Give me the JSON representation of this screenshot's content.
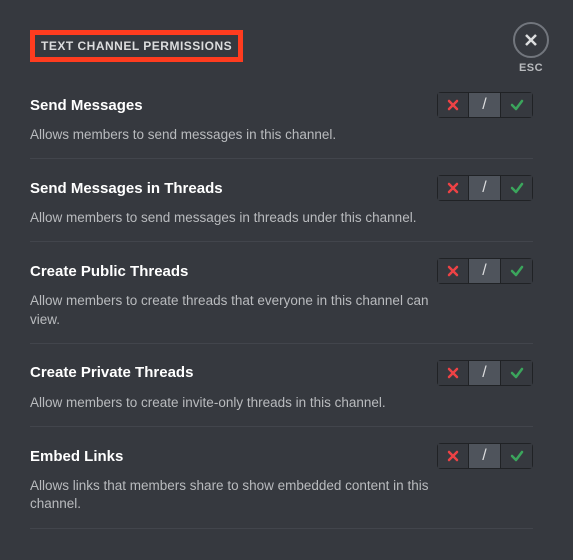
{
  "section_title": "TEXT CHANNEL PERMISSIONS",
  "close": {
    "label": "ESC"
  },
  "toggle": {
    "neutral_char": "/"
  },
  "permissions": [
    {
      "title": "Send Messages",
      "desc": "Allows members to send messages in this channel."
    },
    {
      "title": "Send Messages in Threads",
      "desc": "Allow members to send messages in threads under this channel."
    },
    {
      "title": "Create Public Threads",
      "desc": "Allow members to create threads that everyone in this channel can view."
    },
    {
      "title": "Create Private Threads",
      "desc": "Allow members to create invite-only threads in this channel."
    },
    {
      "title": "Embed Links",
      "desc": "Allows links that members share to show embedded content in this channel."
    }
  ]
}
